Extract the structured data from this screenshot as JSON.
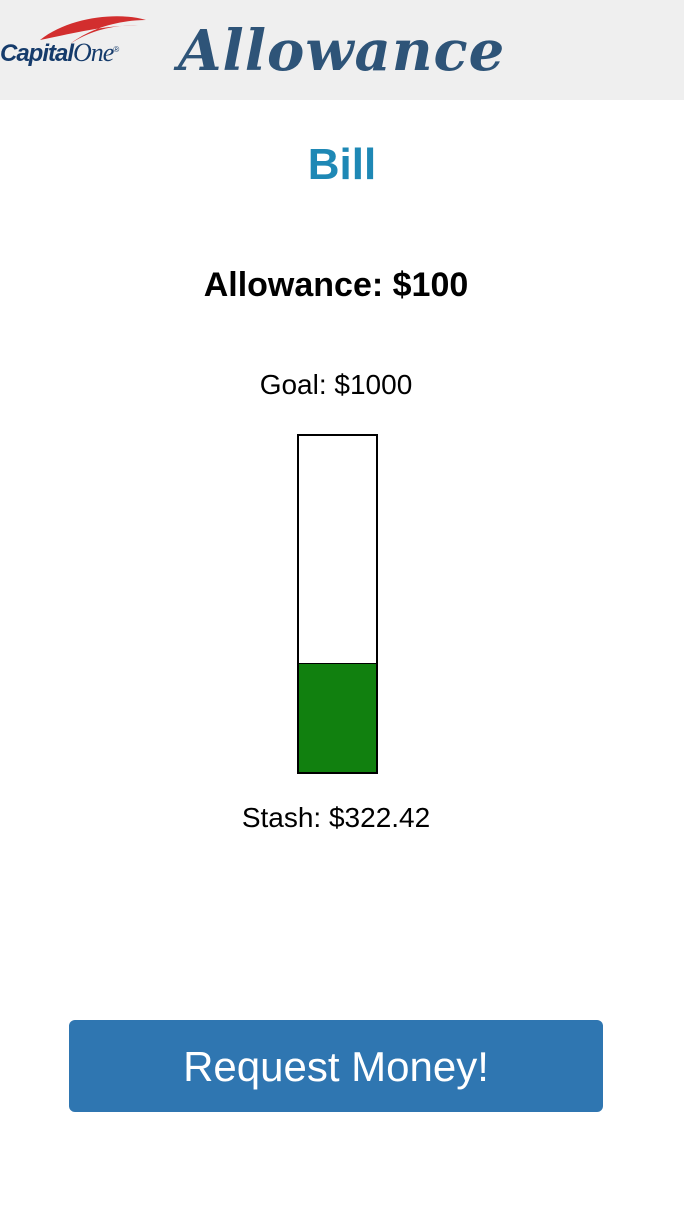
{
  "header": {
    "logo": {
      "icon": "capital-one-logo",
      "text_main": "Capital",
      "text_one": "One",
      "registered": "®",
      "swoosh_color": "#d22e2e",
      "text_color": "#153b6b"
    },
    "title": "Allowance"
  },
  "profile": {
    "name": "Bill",
    "allowance_text": "Allowance: $100",
    "goal_text": "Goal: $1000",
    "stash_text": "Stash: $322.42",
    "goal_amount": 1000,
    "stash_amount": 322.42,
    "progress_fraction": 0.32
  },
  "actions": {
    "request_label": "Request Money!"
  },
  "colors": {
    "header_bg": "#efefef",
    "title": "#2e5478",
    "name": "#1e88b5",
    "progress_fill": "#11800f",
    "button_bg": "#2f76b1"
  }
}
